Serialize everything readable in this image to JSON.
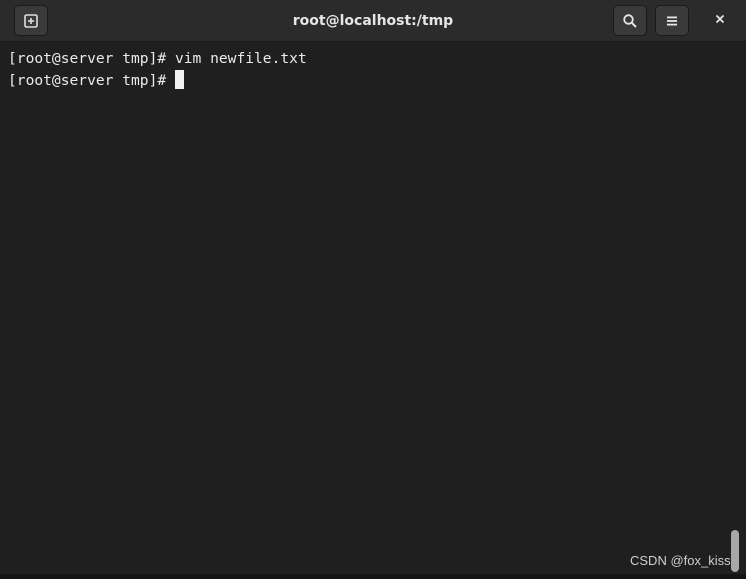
{
  "window": {
    "title": "root@localhost:/tmp"
  },
  "headerbar": {
    "new_tab_icon": "new-tab-icon",
    "search_icon": "search-icon",
    "menu_icon": "hamburger-menu-icon",
    "close_icon": "close-icon"
  },
  "terminal": {
    "lines": [
      {
        "prompt": "[root@server tmp]# ",
        "command": "vim newfile.txt"
      },
      {
        "prompt": "[root@server tmp]# ",
        "command": ""
      }
    ]
  },
  "watermark": "CSDN @fox_kiss",
  "colors": {
    "background": "#1f1f1f",
    "headerbar": "#2b2b2b",
    "text": "#eaeaea",
    "cursor": "#f2f2f2"
  }
}
